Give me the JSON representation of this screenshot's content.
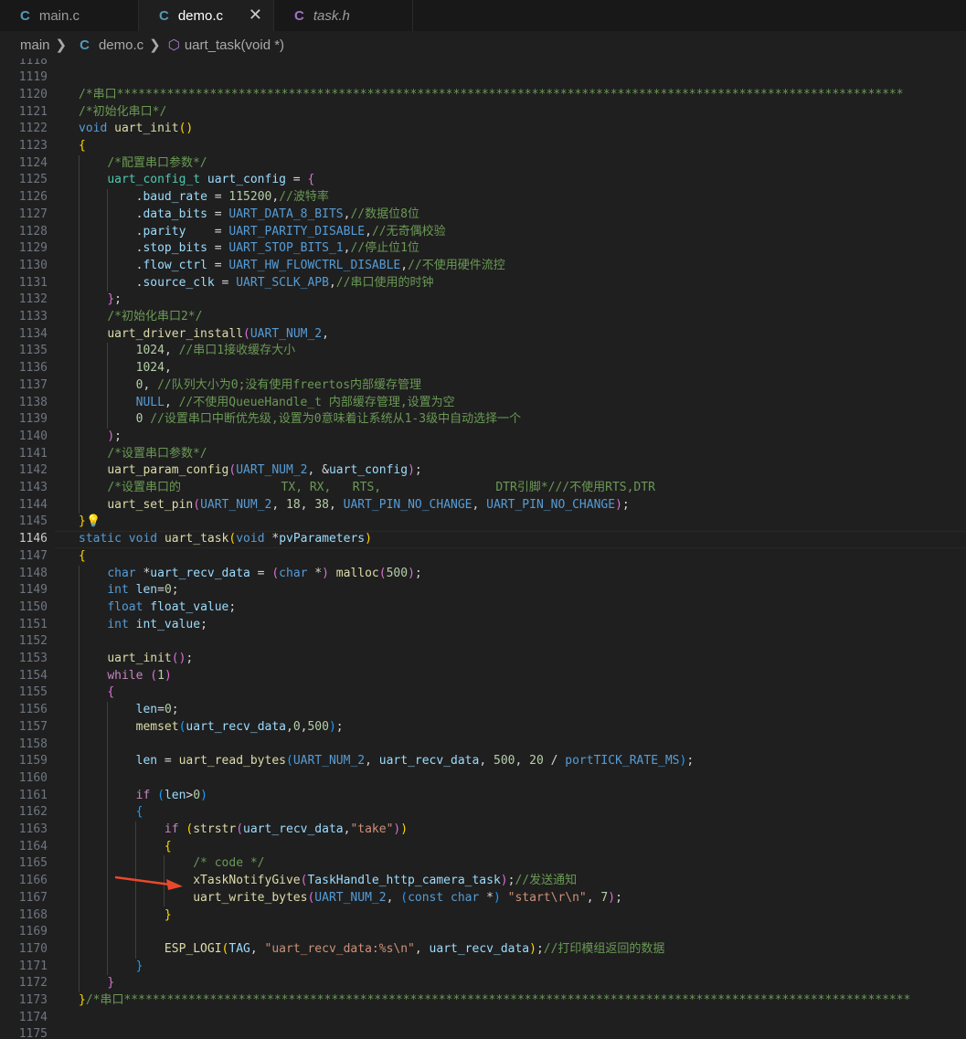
{
  "tabs": [
    {
      "label": "main.c",
      "icon": "C",
      "active": false,
      "italic": false
    },
    {
      "label": "demo.c",
      "icon": "C",
      "active": true,
      "italic": false
    },
    {
      "label": "task.h",
      "icon": "C",
      "active": false,
      "italic": true
    }
  ],
  "close_glyph": "✕",
  "breadcrumb": {
    "folder": "main",
    "file": "demo.c",
    "symbol": "uart_task(void *)"
  },
  "colors": {
    "comment": "#6a9955",
    "keyword": "#569cd6",
    "control": "#c586c0",
    "function": "#dcdcaa",
    "type": "#4ec9b0",
    "variable": "#9cdcfe",
    "number": "#b5cea8",
    "string": "#ce9178",
    "macro": "#569cd6",
    "bracket": "#ffd700",
    "bracket2": "#da70d6",
    "bracket3": "#179fff",
    "plain": "#d4d4d4",
    "arrow": "#e8492b"
  },
  "current_line": 1146,
  "lines": [
    {
      "n": 1118,
      "t": []
    },
    {
      "n": 1119,
      "t": []
    },
    {
      "n": 1120,
      "t": [
        [
          "comment",
          "/*串口**************************************************************************************************************"
        ]
      ]
    },
    {
      "n": 1121,
      "t": [
        [
          "comment",
          "/*初始化串口*/"
        ]
      ]
    },
    {
      "n": 1122,
      "t": [
        [
          "keyword",
          "void"
        ],
        [
          "plain",
          " "
        ],
        [
          "function",
          "uart_init"
        ],
        [
          "bracket",
          "()"
        ]
      ]
    },
    {
      "n": 1123,
      "t": [
        [
          "bracket",
          "{"
        ]
      ]
    },
    {
      "n": 1124,
      "t": [
        [
          "plain",
          "    "
        ],
        [
          "comment",
          "/*配置串口参数*/"
        ]
      ]
    },
    {
      "n": 1125,
      "t": [
        [
          "plain",
          "    "
        ],
        [
          "type",
          "uart_config_t"
        ],
        [
          "plain",
          " "
        ],
        [
          "variable",
          "uart_config"
        ],
        [
          "plain",
          " = "
        ],
        [
          "bracket2",
          "{"
        ]
      ]
    },
    {
      "n": 1126,
      "t": [
        [
          "plain",
          "        ."
        ],
        [
          "variable",
          "baud_rate"
        ],
        [
          "plain",
          " = "
        ],
        [
          "number",
          "115200"
        ],
        [
          "plain",
          ","
        ],
        [
          "comment",
          "//波特率"
        ]
      ]
    },
    {
      "n": 1127,
      "t": [
        [
          "plain",
          "        ."
        ],
        [
          "variable",
          "data_bits"
        ],
        [
          "plain",
          " = "
        ],
        [
          "macro",
          "UART_DATA_8_BITS"
        ],
        [
          "plain",
          ","
        ],
        [
          "comment",
          "//数据位8位"
        ]
      ]
    },
    {
      "n": 1128,
      "t": [
        [
          "plain",
          "        ."
        ],
        [
          "variable",
          "parity"
        ],
        [
          "plain",
          "    = "
        ],
        [
          "macro",
          "UART_PARITY_DISABLE"
        ],
        [
          "plain",
          ","
        ],
        [
          "comment",
          "//无奇偶校验"
        ]
      ]
    },
    {
      "n": 1129,
      "t": [
        [
          "plain",
          "        ."
        ],
        [
          "variable",
          "stop_bits"
        ],
        [
          "plain",
          " = "
        ],
        [
          "macro",
          "UART_STOP_BITS_1"
        ],
        [
          "plain",
          ","
        ],
        [
          "comment",
          "//停止位1位"
        ]
      ]
    },
    {
      "n": 1130,
      "t": [
        [
          "plain",
          "        ."
        ],
        [
          "variable",
          "flow_ctrl"
        ],
        [
          "plain",
          " = "
        ],
        [
          "macro",
          "UART_HW_FLOWCTRL_DISABLE"
        ],
        [
          "plain",
          ","
        ],
        [
          "comment",
          "//不使用硬件流控"
        ]
      ]
    },
    {
      "n": 1131,
      "t": [
        [
          "plain",
          "        ."
        ],
        [
          "variable",
          "source_clk"
        ],
        [
          "plain",
          " = "
        ],
        [
          "macro",
          "UART_SCLK_APB"
        ],
        [
          "plain",
          ","
        ],
        [
          "comment",
          "//串口使用的时钟"
        ]
      ]
    },
    {
      "n": 1132,
      "t": [
        [
          "plain",
          "    "
        ],
        [
          "bracket2",
          "}"
        ],
        [
          "plain",
          ";"
        ]
      ]
    },
    {
      "n": 1133,
      "t": [
        [
          "plain",
          "    "
        ],
        [
          "comment",
          "/*初始化串口2*/"
        ]
      ]
    },
    {
      "n": 1134,
      "t": [
        [
          "plain",
          "    "
        ],
        [
          "function",
          "uart_driver_install"
        ],
        [
          "bracket2",
          "("
        ],
        [
          "macro",
          "UART_NUM_2"
        ],
        [
          "plain",
          ","
        ]
      ]
    },
    {
      "n": 1135,
      "t": [
        [
          "plain",
          "        "
        ],
        [
          "number",
          "1024"
        ],
        [
          "plain",
          ", "
        ],
        [
          "comment",
          "//串口1接收缓存大小"
        ]
      ]
    },
    {
      "n": 1136,
      "t": [
        [
          "plain",
          "        "
        ],
        [
          "number",
          "1024"
        ],
        [
          "plain",
          ","
        ]
      ]
    },
    {
      "n": 1137,
      "t": [
        [
          "plain",
          "        "
        ],
        [
          "number",
          "0"
        ],
        [
          "plain",
          ", "
        ],
        [
          "comment",
          "//队列大小为0;没有使用freertos内部缓存管理"
        ]
      ]
    },
    {
      "n": 1138,
      "t": [
        [
          "plain",
          "        "
        ],
        [
          "macro",
          "NULL"
        ],
        [
          "plain",
          ", "
        ],
        [
          "comment",
          "//不使用QueueHandle_t 内部缓存管理,设置为空"
        ]
      ]
    },
    {
      "n": 1139,
      "t": [
        [
          "plain",
          "        "
        ],
        [
          "number",
          "0"
        ],
        [
          "plain",
          " "
        ],
        [
          "comment",
          "//设置串口中断优先级,设置为0意味着让系统从1-3级中自动选择一个"
        ]
      ]
    },
    {
      "n": 1140,
      "t": [
        [
          "plain",
          "    "
        ],
        [
          "bracket2",
          ")"
        ],
        [
          "plain",
          ";"
        ]
      ]
    },
    {
      "n": 1141,
      "t": [
        [
          "plain",
          "    "
        ],
        [
          "comment",
          "/*设置串口参数*/"
        ]
      ]
    },
    {
      "n": 1142,
      "t": [
        [
          "plain",
          "    "
        ],
        [
          "function",
          "uart_param_config"
        ],
        [
          "bracket2",
          "("
        ],
        [
          "macro",
          "UART_NUM_2"
        ],
        [
          "plain",
          ", &"
        ],
        [
          "variable",
          "uart_config"
        ],
        [
          "bracket2",
          ")"
        ],
        [
          "plain",
          ";"
        ]
      ]
    },
    {
      "n": 1143,
      "t": [
        [
          "plain",
          "    "
        ],
        [
          "comment",
          "/*设置串口的              TX, RX,   RTS,                DTR引脚*///不使用RTS,DTR"
        ]
      ]
    },
    {
      "n": 1144,
      "t": [
        [
          "plain",
          "    "
        ],
        [
          "function",
          "uart_set_pin"
        ],
        [
          "bracket2",
          "("
        ],
        [
          "macro",
          "UART_NUM_2"
        ],
        [
          "plain",
          ", "
        ],
        [
          "number",
          "18"
        ],
        [
          "plain",
          ", "
        ],
        [
          "number",
          "38"
        ],
        [
          "plain",
          ", "
        ],
        [
          "macro",
          "UART_PIN_NO_CHANGE"
        ],
        [
          "plain",
          ", "
        ],
        [
          "macro",
          "UART_PIN_NO_CHANGE"
        ],
        [
          "bracket2",
          ")"
        ],
        [
          "plain",
          ";"
        ]
      ]
    },
    {
      "n": 1145,
      "t": [
        [
          "bracket",
          "}"
        ]
      ]
    },
    {
      "n": 1146,
      "t": [
        [
          "keyword",
          "static"
        ],
        [
          "plain",
          " "
        ],
        [
          "keyword",
          "void"
        ],
        [
          "plain",
          " "
        ],
        [
          "function",
          "uart_task"
        ],
        [
          "bracket",
          "("
        ],
        [
          "keyword",
          "void"
        ],
        [
          "plain",
          " *"
        ],
        [
          "variable",
          "pvParameters"
        ],
        [
          "bracket",
          ")"
        ]
      ]
    },
    {
      "n": 1147,
      "t": [
        [
          "bracket",
          "{"
        ]
      ]
    },
    {
      "n": 1148,
      "t": [
        [
          "plain",
          "    "
        ],
        [
          "keyword",
          "char"
        ],
        [
          "plain",
          " *"
        ],
        [
          "variable",
          "uart_recv_data"
        ],
        [
          "plain",
          " = "
        ],
        [
          "bracket2",
          "("
        ],
        [
          "keyword",
          "char"
        ],
        [
          "plain",
          " *"
        ],
        [
          "bracket2",
          ")"
        ],
        [
          "plain",
          " "
        ],
        [
          "function",
          "malloc"
        ],
        [
          "bracket2",
          "("
        ],
        [
          "number",
          "500"
        ],
        [
          "bracket2",
          ")"
        ],
        [
          "plain",
          ";"
        ]
      ]
    },
    {
      "n": 1149,
      "t": [
        [
          "plain",
          "    "
        ],
        [
          "keyword",
          "int"
        ],
        [
          "plain",
          " "
        ],
        [
          "variable",
          "len"
        ],
        [
          "plain",
          "="
        ],
        [
          "number",
          "0"
        ],
        [
          "plain",
          ";"
        ]
      ]
    },
    {
      "n": 1150,
      "t": [
        [
          "plain",
          "    "
        ],
        [
          "keyword",
          "float"
        ],
        [
          "plain",
          " "
        ],
        [
          "variable",
          "float_value"
        ],
        [
          "plain",
          ";"
        ]
      ]
    },
    {
      "n": 1151,
      "t": [
        [
          "plain",
          "    "
        ],
        [
          "keyword",
          "int"
        ],
        [
          "plain",
          " "
        ],
        [
          "variable",
          "int_value"
        ],
        [
          "plain",
          ";"
        ]
      ]
    },
    {
      "n": 1152,
      "t": []
    },
    {
      "n": 1153,
      "t": [
        [
          "plain",
          "    "
        ],
        [
          "function",
          "uart_init"
        ],
        [
          "bracket2",
          "()"
        ],
        [
          "plain",
          ";"
        ]
      ]
    },
    {
      "n": 1154,
      "t": [
        [
          "plain",
          "    "
        ],
        [
          "control",
          "while"
        ],
        [
          "plain",
          " "
        ],
        [
          "bracket2",
          "("
        ],
        [
          "number",
          "1"
        ],
        [
          "bracket2",
          ")"
        ]
      ]
    },
    {
      "n": 1155,
      "t": [
        [
          "plain",
          "    "
        ],
        [
          "bracket2",
          "{"
        ]
      ]
    },
    {
      "n": 1156,
      "t": [
        [
          "plain",
          "        "
        ],
        [
          "variable",
          "len"
        ],
        [
          "plain",
          "="
        ],
        [
          "number",
          "0"
        ],
        [
          "plain",
          ";"
        ]
      ]
    },
    {
      "n": 1157,
      "t": [
        [
          "plain",
          "        "
        ],
        [
          "function",
          "memset"
        ],
        [
          "bracket3",
          "("
        ],
        [
          "variable",
          "uart_recv_data"
        ],
        [
          "plain",
          ","
        ],
        [
          "number",
          "0"
        ],
        [
          "plain",
          ","
        ],
        [
          "number",
          "500"
        ],
        [
          "bracket3",
          ")"
        ],
        [
          "plain",
          ";"
        ]
      ]
    },
    {
      "n": 1158,
      "t": []
    },
    {
      "n": 1159,
      "t": [
        [
          "plain",
          "        "
        ],
        [
          "variable",
          "len"
        ],
        [
          "plain",
          " = "
        ],
        [
          "function",
          "uart_read_bytes"
        ],
        [
          "bracket3",
          "("
        ],
        [
          "macro",
          "UART_NUM_2"
        ],
        [
          "plain",
          ", "
        ],
        [
          "variable",
          "uart_recv_data"
        ],
        [
          "plain",
          ", "
        ],
        [
          "number",
          "500"
        ],
        [
          "plain",
          ", "
        ],
        [
          "number",
          "20"
        ],
        [
          "plain",
          " / "
        ],
        [
          "macro",
          "portTICK_RATE_MS"
        ],
        [
          "bracket3",
          ")"
        ],
        [
          "plain",
          ";"
        ]
      ]
    },
    {
      "n": 1160,
      "t": []
    },
    {
      "n": 1161,
      "t": [
        [
          "plain",
          "        "
        ],
        [
          "control",
          "if"
        ],
        [
          "plain",
          " "
        ],
        [
          "bracket3",
          "("
        ],
        [
          "variable",
          "len"
        ],
        [
          "plain",
          ">"
        ],
        [
          "number",
          "0"
        ],
        [
          "bracket3",
          ")"
        ]
      ]
    },
    {
      "n": 1162,
      "t": [
        [
          "plain",
          "        "
        ],
        [
          "bracket3",
          "{"
        ]
      ]
    },
    {
      "n": 1163,
      "t": [
        [
          "plain",
          "            "
        ],
        [
          "control",
          "if"
        ],
        [
          "plain",
          " "
        ],
        [
          "bracket",
          "("
        ],
        [
          "function",
          "strstr"
        ],
        [
          "bracket2",
          "("
        ],
        [
          "variable",
          "uart_recv_data"
        ],
        [
          "plain",
          ","
        ],
        [
          "string",
          "\"take\""
        ],
        [
          "bracket2",
          ")"
        ],
        [
          "bracket",
          ")"
        ]
      ]
    },
    {
      "n": 1164,
      "t": [
        [
          "plain",
          "            "
        ],
        [
          "bracket",
          "{"
        ]
      ]
    },
    {
      "n": 1165,
      "t": [
        [
          "plain",
          "                "
        ],
        [
          "comment",
          "/* code */"
        ]
      ]
    },
    {
      "n": 1166,
      "t": [
        [
          "plain",
          "                "
        ],
        [
          "function",
          "xTaskNotifyGive"
        ],
        [
          "bracket2",
          "("
        ],
        [
          "variable",
          "TaskHandle_http_camera_task"
        ],
        [
          "bracket2",
          ")"
        ],
        [
          "plain",
          ";"
        ],
        [
          "comment",
          "//发送通知"
        ]
      ]
    },
    {
      "n": 1167,
      "t": [
        [
          "plain",
          "                "
        ],
        [
          "function",
          "uart_write_bytes"
        ],
        [
          "bracket2",
          "("
        ],
        [
          "macro",
          "UART_NUM_2"
        ],
        [
          "plain",
          ", "
        ],
        [
          "bracket3",
          "("
        ],
        [
          "keyword",
          "const"
        ],
        [
          "plain",
          " "
        ],
        [
          "keyword",
          "char"
        ],
        [
          "plain",
          " *"
        ],
        [
          "bracket3",
          ")"
        ],
        [
          "plain",
          " "
        ],
        [
          "string",
          "\"start\\r\\n\""
        ],
        [
          "plain",
          ", "
        ],
        [
          "number",
          "7"
        ],
        [
          "bracket2",
          ")"
        ],
        [
          "plain",
          ";"
        ]
      ]
    },
    {
      "n": 1168,
      "t": [
        [
          "plain",
          "            "
        ],
        [
          "bracket",
          "}"
        ]
      ]
    },
    {
      "n": 1169,
      "t": []
    },
    {
      "n": 1170,
      "t": [
        [
          "plain",
          "            "
        ],
        [
          "function",
          "ESP_LOGI"
        ],
        [
          "bracket",
          "("
        ],
        [
          "variable",
          "TAG"
        ],
        [
          "plain",
          ", "
        ],
        [
          "string",
          "\"uart_recv_data:%s\\n\""
        ],
        [
          "plain",
          ", "
        ],
        [
          "variable",
          "uart_recv_data"
        ],
        [
          "bracket",
          ")"
        ],
        [
          "plain",
          ";"
        ],
        [
          "comment",
          "//打印模组返回的数据"
        ]
      ]
    },
    {
      "n": 1171,
      "t": [
        [
          "plain",
          "        "
        ],
        [
          "bracket3",
          "}"
        ]
      ]
    },
    {
      "n": 1172,
      "t": [
        [
          "plain",
          "    "
        ],
        [
          "bracket2",
          "}"
        ]
      ]
    },
    {
      "n": 1173,
      "t": [
        [
          "bracket",
          "}"
        ],
        [
          "comment",
          "/*串口**************************************************************************************************************"
        ]
      ]
    },
    {
      "n": 1174,
      "t": []
    },
    {
      "n": 1175,
      "t": []
    }
  ]
}
